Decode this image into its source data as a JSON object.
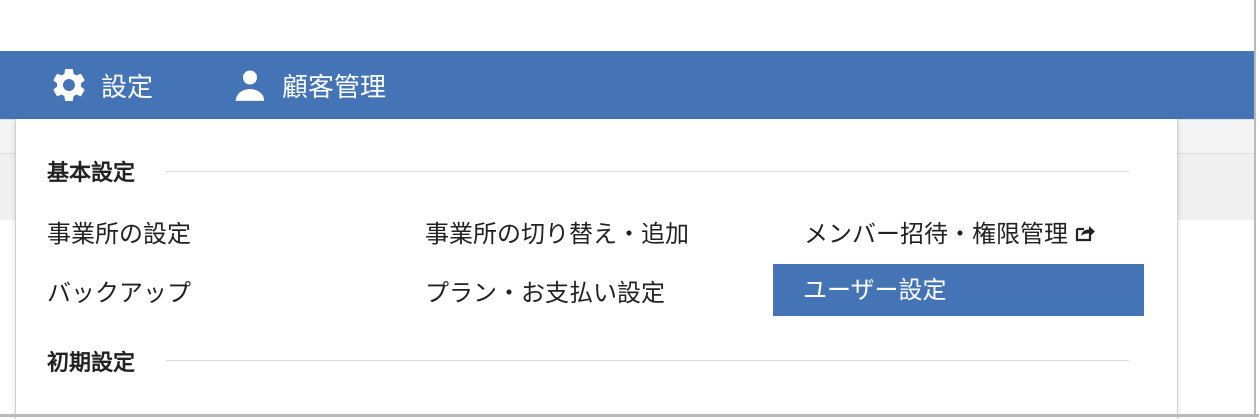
{
  "navbar": {
    "settings_label": "設定",
    "customers_label": "顧客管理",
    "color": "#4574b6"
  },
  "dropdown": {
    "basic_section_title": "基本設定",
    "items": {
      "office_settings": "事業所の設定",
      "switch_add_office": "事業所の切り替え・追加",
      "member_invite": "メンバー招待・権限管理",
      "backup": "バックアップ",
      "plan_payment": "プラン・お支払い設定",
      "user_settings": "ユーザー設定"
    },
    "initial_section_title": "初期設定",
    "icons": {
      "settings": "gear-icon",
      "customers": "user-icon",
      "member_invite": "external-share-icon"
    }
  }
}
